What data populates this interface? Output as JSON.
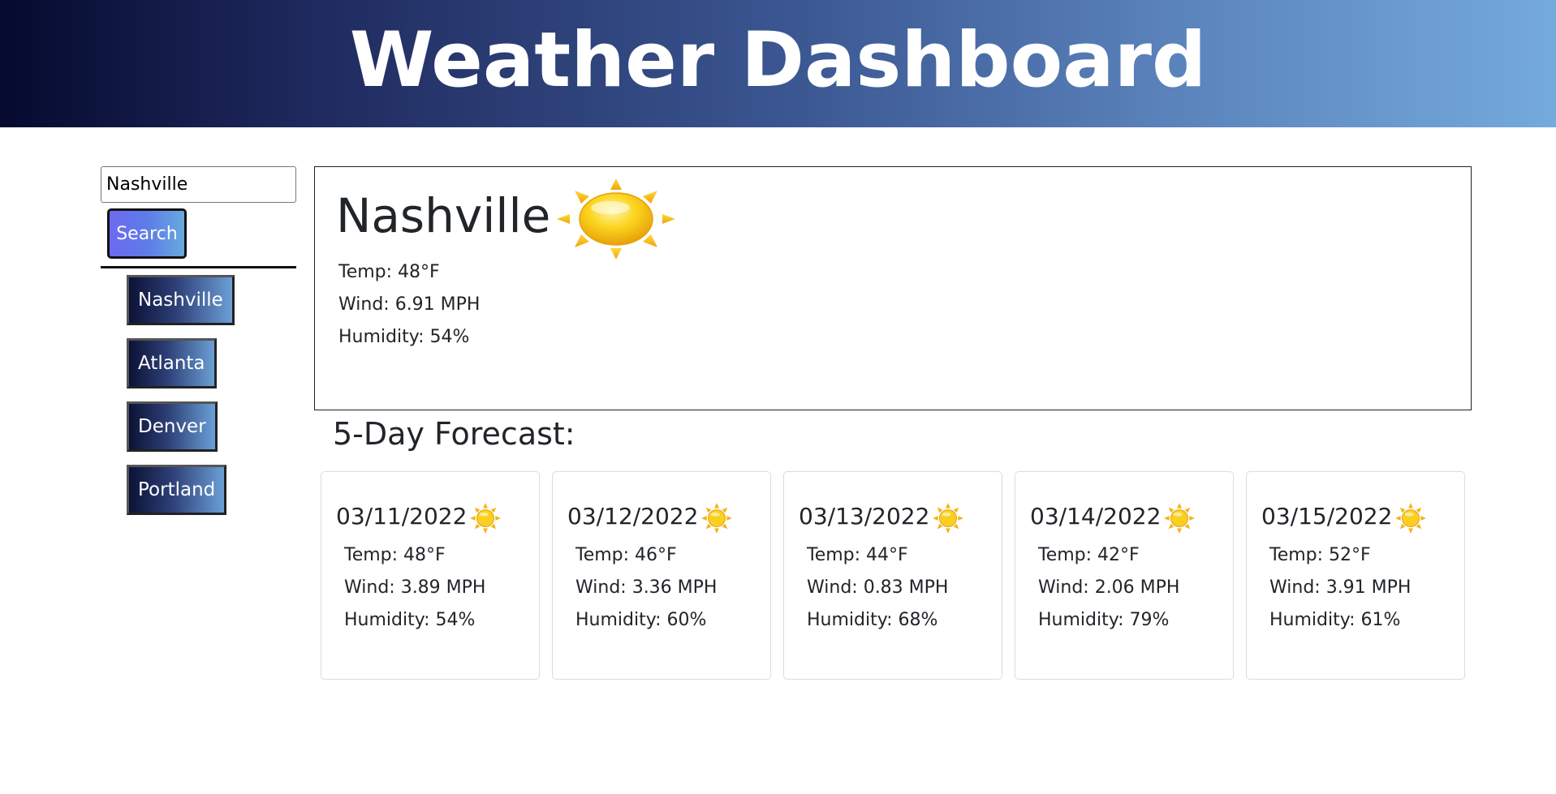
{
  "header": {
    "title": "Weather Dashboard"
  },
  "search": {
    "value": "Nashville",
    "button_label": "Search"
  },
  "history": [
    {
      "label": "Nashville"
    },
    {
      "label": "Atlanta"
    },
    {
      "label": "Denver"
    },
    {
      "label": "Portland"
    }
  ],
  "current": {
    "city": "Nashville",
    "icon": "sun-icon",
    "temp": "Temp: 48°F",
    "wind": "Wind: 6.91 MPH",
    "humidity": "Humidity: 54%"
  },
  "forecast": {
    "title": "5-Day Forecast:",
    "days": [
      {
        "date": "03/11/2022",
        "icon": "sun-icon",
        "temp": "Temp: 48°F",
        "wind": "Wind: 3.89 MPH",
        "humidity": "Humidity: 54%"
      },
      {
        "date": "03/12/2022",
        "icon": "sun-icon",
        "temp": "Temp: 46°F",
        "wind": "Wind: 3.36 MPH",
        "humidity": "Humidity: 60%"
      },
      {
        "date": "03/13/2022",
        "icon": "sun-icon",
        "temp": "Temp: 44°F",
        "wind": "Wind: 0.83 MPH",
        "humidity": "Humidity: 68%"
      },
      {
        "date": "03/14/2022",
        "icon": "sun-icon",
        "temp": "Temp: 42°F",
        "wind": "Wind: 2.06 MPH",
        "humidity": "Humidity: 79%"
      },
      {
        "date": "03/15/2022",
        "icon": "sun-icon",
        "temp": "Temp: 52°F",
        "wind": "Wind: 3.91 MPH",
        "humidity": "Humidity: 61%"
      }
    ]
  },
  "colors": {
    "header_gradient_start": "#050a2e",
    "header_gradient_end": "#74aade",
    "search_button_start": "#6d69f0",
    "sun_yellow": "#f7c21a"
  }
}
